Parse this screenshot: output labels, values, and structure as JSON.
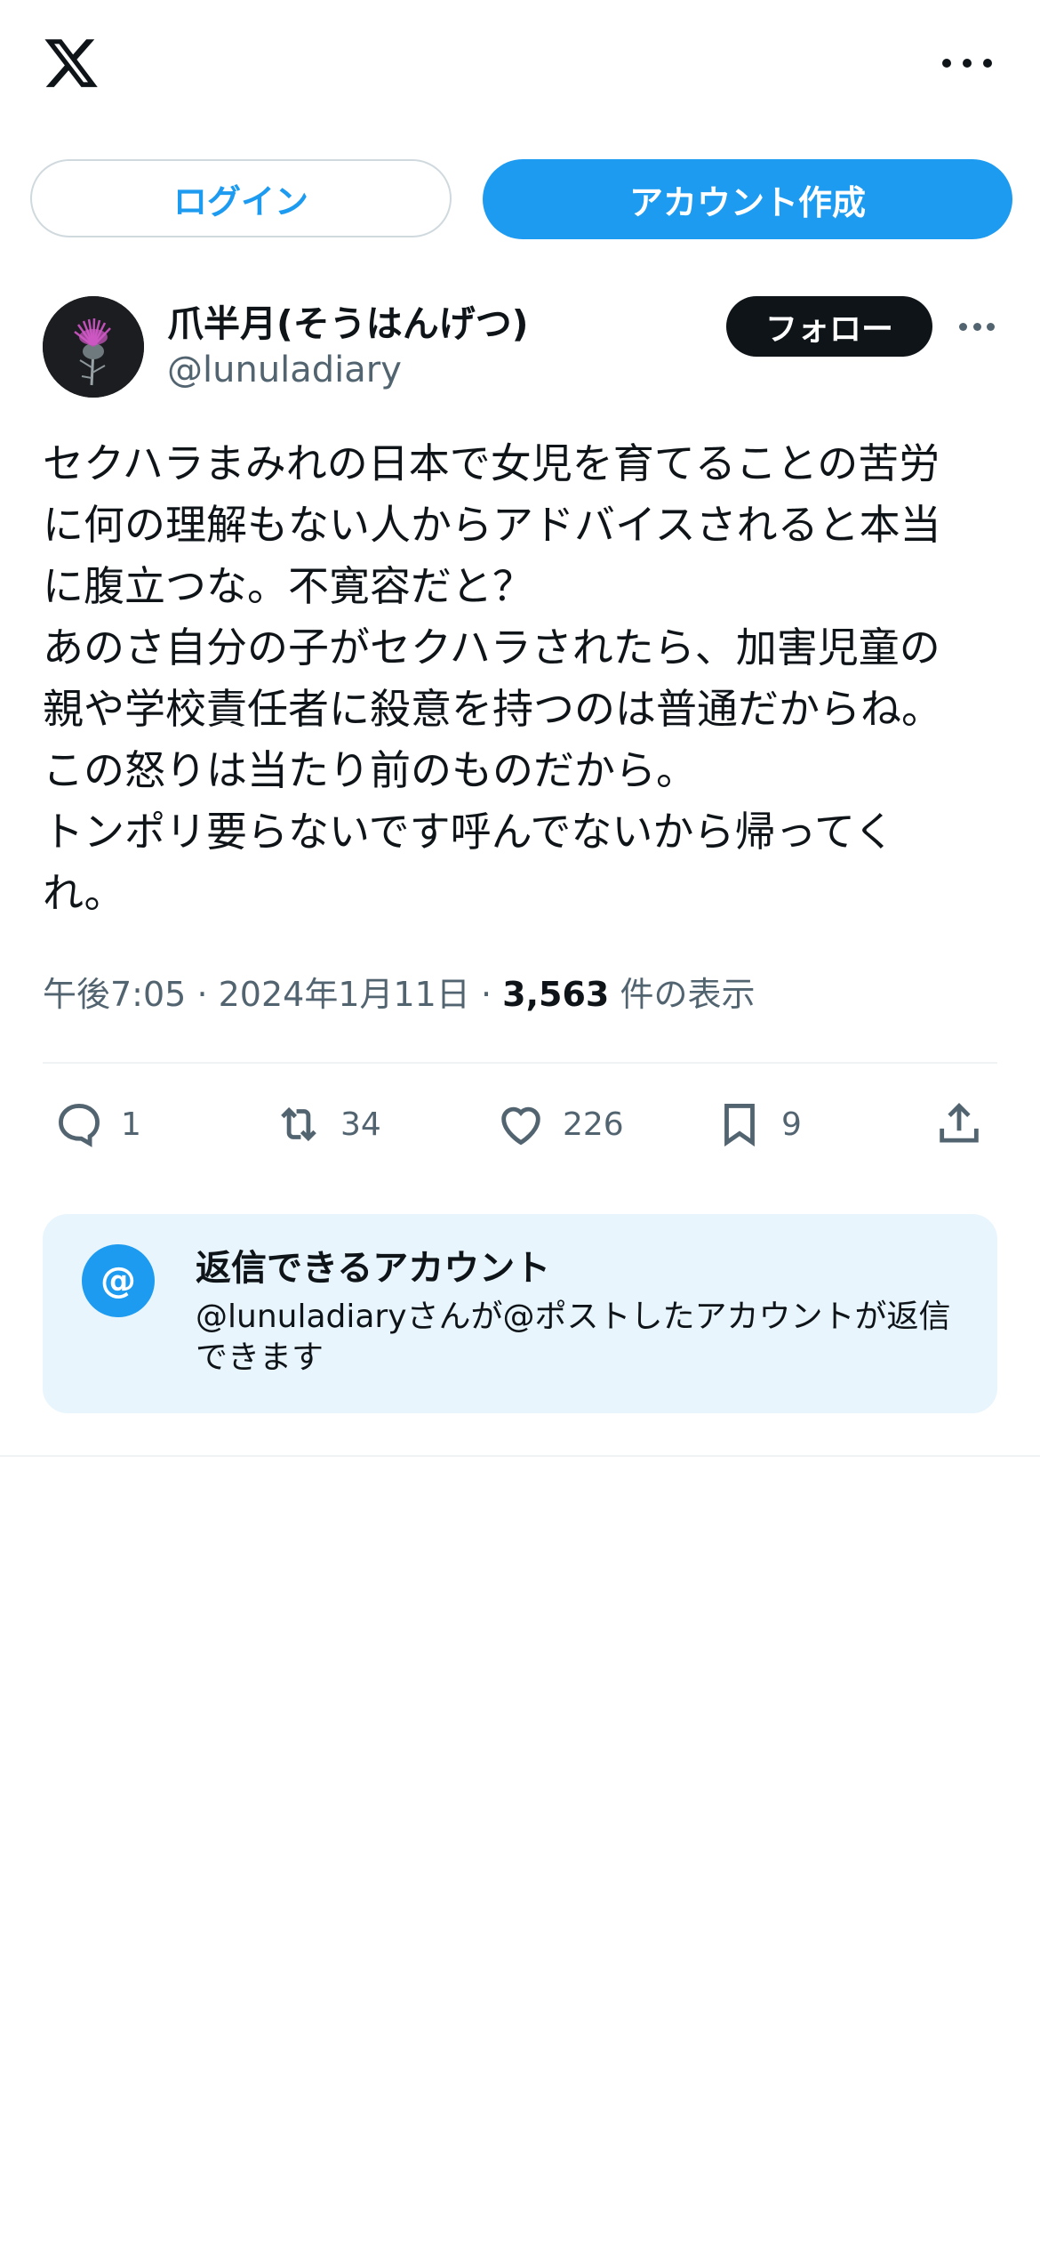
{
  "header": {
    "logo_icon": "x-logo-icon",
    "more_icon": "more-horizontal-icon"
  },
  "auth": {
    "login_label": "ログイン",
    "signup_label": "アカウント作成"
  },
  "post": {
    "author": {
      "display_name": "爪半月(そうはんげつ)",
      "handle": "@lunuladiary",
      "avatar_icon": "thistle-flower-avatar"
    },
    "follow_label": "フォロー",
    "text": "セクハラまみれの日本で女児を育てることの苦労\nに何の理解もない人からアドバイスされると本当\nに腹立つな。不寛容だと？\nあのさ自分の子がセクハラされたら、加害児童の\n親や学校責任者に殺意を持つのは普通だからね。\nこの怒りは当たり前のものだから。\nトンポリ要らないです呼んでないから帰ってく\nれ。",
    "time": "午後7:05",
    "date": "2024年1月11日",
    "separator": "·",
    "views_count": "3,563",
    "views_label": "件の表示",
    "actions": {
      "reply_count": "1",
      "repost_count": "34",
      "like_count": "226",
      "bookmark_count": "9"
    }
  },
  "reply_settings": {
    "icon_glyph": "@",
    "title": "返信できるアカウント",
    "description": "@lunuladiaryさんが@ポストしたアカウントが返信できます"
  },
  "colors": {
    "accent": "#1d9bf0",
    "text": "#0f1419",
    "secondary_text": "#536471",
    "reply_box_bg": "#e8f5fd"
  }
}
